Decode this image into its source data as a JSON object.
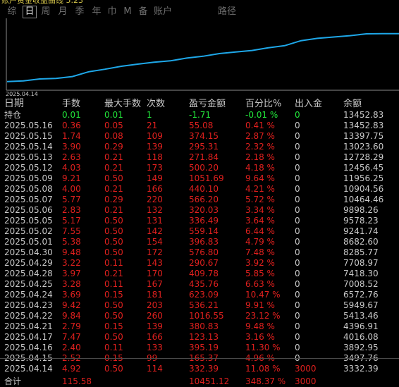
{
  "window": {
    "title": "账户资金收益曲线 5.23"
  },
  "tabs": [
    {
      "label": "综",
      "active": false
    },
    {
      "label": "日",
      "active": true
    },
    {
      "label": "周",
      "active": false
    },
    {
      "label": "月",
      "active": false
    },
    {
      "label": "季",
      "active": false
    },
    {
      "label": "年",
      "active": false
    },
    {
      "label": "巾",
      "active": false
    },
    {
      "label": "M",
      "active": false
    },
    {
      "label": "备",
      "active": false
    },
    {
      "label": "账户",
      "active": false
    },
    {
      "label": "路径",
      "active": false
    }
  ],
  "colors": {
    "line": "#1ea7e8",
    "profit": "#e0201e",
    "loss": "#22e53a",
    "text": "#c8c8c8",
    "axis": "#8a8a8a"
  },
  "chart_data": {
    "type": "line",
    "x_start_label": "2025.04.14",
    "series": [
      {
        "values": [
          3332.39,
          3497.76,
          3892.95,
          4016.08,
          4396.91,
          5413.46,
          5949.67,
          6572.76,
          7008.52,
          7418.3,
          7708.97,
          8285.77,
          8682.6,
          9241.74,
          9578.23,
          9898.26,
          10464.46,
          10904.56,
          11956.25,
          12456.45,
          12728.29,
          13023.6,
          13397.75,
          13452.83,
          13452.83
        ]
      }
    ]
  },
  "table": {
    "headers": [
      "日期",
      "手数",
      "最大手数",
      "次数",
      "盈亏金额",
      "百分比%",
      "出入金",
      "余额"
    ],
    "holding": {
      "date": "持仓",
      "lots": "0.01",
      "max_lots": "0.01",
      "count": "1",
      "pnl": "-1.71",
      "pct": "-0.01 %",
      "flow": "0",
      "balance": "13452.83"
    },
    "rows": [
      {
        "date": "2025.05.16",
        "lots": "0.36",
        "max_lots": "0.05",
        "count": "21",
        "pnl": "55.08",
        "pct": "0.41 %",
        "flow": "0",
        "balance": "13452.83"
      },
      {
        "date": "2025.05.15",
        "lots": "1.74",
        "max_lots": "0.08",
        "count": "109",
        "pnl": "374.15",
        "pct": "2.87 %",
        "flow": "0",
        "balance": "13397.75"
      },
      {
        "date": "2025.05.14",
        "lots": "3.90",
        "max_lots": "0.29",
        "count": "139",
        "pnl": "295.31",
        "pct": "2.32 %",
        "flow": "0",
        "balance": "13023.60"
      },
      {
        "date": "2025.05.13",
        "lots": "2.63",
        "max_lots": "0.21",
        "count": "118",
        "pnl": "271.84",
        "pct": "2.18 %",
        "flow": "0",
        "balance": "12728.29"
      },
      {
        "date": "2025.05.12",
        "lots": "4.03",
        "max_lots": "0.21",
        "count": "173",
        "pnl": "500.20",
        "pct": "4.18 %",
        "flow": "0",
        "balance": "12456.45"
      },
      {
        "date": "2025.05.09",
        "lots": "9.21",
        "max_lots": "0.50",
        "count": "149",
        "pnl": "1051.69",
        "pct": "9.64 %",
        "flow": "0",
        "balance": "11956.25"
      },
      {
        "date": "2025.05.08",
        "lots": "4.00",
        "max_lots": "0.21",
        "count": "166",
        "pnl": "440.10",
        "pct": "4.21 %",
        "flow": "0",
        "balance": "10904.56"
      },
      {
        "date": "2025.05.07",
        "lots": "5.77",
        "max_lots": "0.29",
        "count": "220",
        "pnl": "566.20",
        "pct": "5.72 %",
        "flow": "0",
        "balance": "10464.46"
      },
      {
        "date": "2025.05.06",
        "lots": "2.83",
        "max_lots": "0.21",
        "count": "132",
        "pnl": "320.03",
        "pct": "3.34 %",
        "flow": "0",
        "balance": "9898.26"
      },
      {
        "date": "2025.05.05",
        "lots": "5.17",
        "max_lots": "0.50",
        "count": "131",
        "pnl": "336.49",
        "pct": "3.64 %",
        "flow": "0",
        "balance": "9578.23"
      },
      {
        "date": "2025.05.02",
        "lots": "7.55",
        "max_lots": "0.50",
        "count": "142",
        "pnl": "559.14",
        "pct": "6.44 %",
        "flow": "0",
        "balance": "9241.74"
      },
      {
        "date": "2025.05.01",
        "lots": "5.38",
        "max_lots": "0.50",
        "count": "154",
        "pnl": "396.83",
        "pct": "4.79 %",
        "flow": "0",
        "balance": "8682.60"
      },
      {
        "date": "2025.04.30",
        "lots": "9.48",
        "max_lots": "0.50",
        "count": "172",
        "pnl": "576.80",
        "pct": "7.48 %",
        "flow": "0",
        "balance": "8285.77"
      },
      {
        "date": "2025.04.29",
        "lots": "3.22",
        "max_lots": "0.11",
        "count": "143",
        "pnl": "290.67",
        "pct": "3.92 %",
        "flow": "0",
        "balance": "7708.97"
      },
      {
        "date": "2025.04.28",
        "lots": "3.97",
        "max_lots": "0.21",
        "count": "170",
        "pnl": "409.78",
        "pct": "5.85 %",
        "flow": "0",
        "balance": "7418.30"
      },
      {
        "date": "2025.04.25",
        "lots": "3.28",
        "max_lots": "0.11",
        "count": "167",
        "pnl": "435.76",
        "pct": "6.63 %",
        "flow": "0",
        "balance": "7008.52"
      },
      {
        "date": "2025.04.24",
        "lots": "3.69",
        "max_lots": "0.15",
        "count": "181",
        "pnl": "623.09",
        "pct": "10.47 %",
        "flow": "0",
        "balance": "6572.76"
      },
      {
        "date": "2025.04.23",
        "lots": "9.42",
        "max_lots": "0.50",
        "count": "203",
        "pnl": "536.21",
        "pct": "9.91 %",
        "flow": "0",
        "balance": "5949.67"
      },
      {
        "date": "2025.04.22",
        "lots": "9.84",
        "max_lots": "0.50",
        "count": "260",
        "pnl": "1016.55",
        "pct": "23.12 %",
        "flow": "0",
        "balance": "5413.46"
      },
      {
        "date": "2025.04.21",
        "lots": "2.79",
        "max_lots": "0.15",
        "count": "139",
        "pnl": "380.83",
        "pct": "9.48 %",
        "flow": "0",
        "balance": "4396.91"
      },
      {
        "date": "2025.04.17",
        "lots": "7.47",
        "max_lots": "0.50",
        "count": "166",
        "pnl": "123.13",
        "pct": "3.16 %",
        "flow": "0",
        "balance": "4016.08"
      },
      {
        "date": "2025.04.16",
        "lots": "2.40",
        "max_lots": "0.11",
        "count": "133",
        "pnl": "395.19",
        "pct": "11.30 %",
        "flow": "0",
        "balance": "3892.95"
      },
      {
        "date": "2025.04.15",
        "lots": "2.52",
        "max_lots": "0.15",
        "count": "99",
        "pnl": "165.37",
        "pct": "4.96 %",
        "flow": "0",
        "balance": "3497.76"
      },
      {
        "date": "2025.04.14",
        "lots": "4.92",
        "max_lots": "0.50",
        "count": "114",
        "pnl": "332.39",
        "pct": "11.08 %",
        "flow": "3000",
        "balance": "3332.39"
      }
    ],
    "total": {
      "label": "合计",
      "lots": "115.58",
      "pnl": "10451.12",
      "pct": "348.37 %",
      "flow": "3000"
    }
  }
}
